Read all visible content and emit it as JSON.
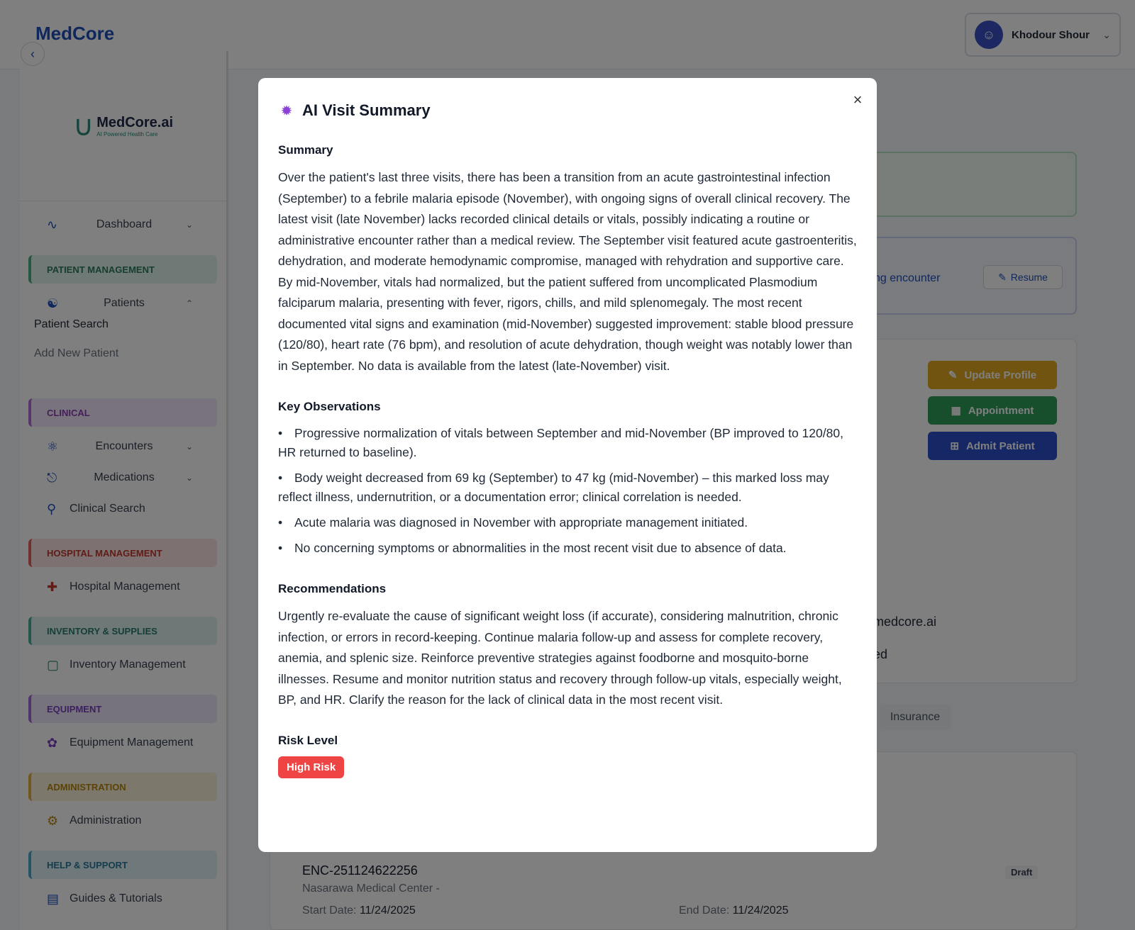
{
  "app": {
    "brand": "MedCore",
    "user_name": "Khodour Shour",
    "logo_name": "MedCore.ai",
    "logo_sub": "AI Powered Health Care"
  },
  "sidebar": {
    "dashboard": "Dashboard",
    "sections": {
      "patient_management": "PATIENT MANAGEMENT",
      "clinical": "CLINICAL",
      "hospital_management": "HOSPITAL MANAGEMENT",
      "inventory": "INVENTORY & SUPPLIES",
      "equipment": "EQUIPMENT",
      "administration": "ADMINISTRATION",
      "help": "HELP & SUPPORT"
    },
    "patients": "Patients",
    "patient_search": "Patient Search",
    "add_new_patient": "Add New Patient",
    "encounters": "Encounters",
    "medications": "Medications",
    "clinical_search": "Clinical Search",
    "hospital_mgmt_item": "Hospital Management",
    "inventory_mgmt_item": "Inventory Management",
    "equipment_mgmt_item": "Equipment Management",
    "administration_item": "Administration",
    "guides": "Guides & Tutorials"
  },
  "main": {
    "ongoing_encounter_partial": "ng encounter",
    "resume": "Resume",
    "update_profile": "Update Profile",
    "appointment": "Appointment",
    "admit_patient": "Admit Patient",
    "email_partial": "medcore.ai",
    "status_partial": "ed",
    "insurance_tab": "Insurance",
    "encounter_id": "ENC-251124622256",
    "encounter_status": "Draft",
    "encounter_location": "Nasarawa Medical Center -",
    "start_date_label": "Start Date:",
    "start_date": "11/24/2025",
    "end_date_label": "End Date:",
    "end_date": "11/24/2025"
  },
  "modal": {
    "title": "AI Visit Summary",
    "summary_heading": "Summary",
    "summary_text": "Over the patient's last three visits, there has been a transition from an acute gastrointestinal infection (September) to a febrile malaria episode (November), with ongoing signs of overall clinical recovery. The latest visit (late November) lacks recorded clinical details or vitals, possibly indicating a routine or administrative encounter rather than a medical review. The September visit featured acute gastroenteritis, dehydration, and moderate hemodynamic compromise, managed with rehydration and supportive care. By mid-November, vitals had normalized, but the patient suffered from uncomplicated Plasmodium falciparum malaria, presenting with fever, rigors, chills, and mild splenomegaly. The most recent documented vital signs and examination (mid-November) suggested improvement: stable blood pressure (120/80), heart rate (76 bpm), and resolution of acute dehydration, though weight was notably lower than in September. No data is available from the latest (late-November) visit.",
    "observations_heading": "Key Observations",
    "observations": [
      "Progressive normalization of vitals between September and mid-November (BP improved to 120/80, HR returned to baseline).",
      "Body weight decreased from 69 kg (September) to 47 kg (mid-November) – this marked loss may reflect illness, undernutrition, or a documentation error; clinical correlation is needed.",
      "Acute malaria was diagnosed in November with appropriate management initiated.",
      "No concerning symptoms or abnormalities in the most recent visit due to absence of data."
    ],
    "recommendations_heading": "Recommendations",
    "recommendations_text": "Urgently re-evaluate the cause of significant weight loss (if accurate), considering malnutrition, chronic infection, or errors in record-keeping. Continue malaria follow-up and assess for complete recovery, anemia, and splenic size. Reinforce preventive strategies against foodborne and mosquito-borne illnesses. Resume and monitor nutrition status and recovery through follow-up vitals, especially weight, BP, and HR. Clarify the reason for the lack of clinical data in the most recent visit.",
    "risk_heading": "Risk Level",
    "risk_badge": "High Risk"
  },
  "colors": {
    "brand": "#1e4fb8",
    "risk": "#ef4444",
    "ai_icon": "#8b3fd9"
  }
}
